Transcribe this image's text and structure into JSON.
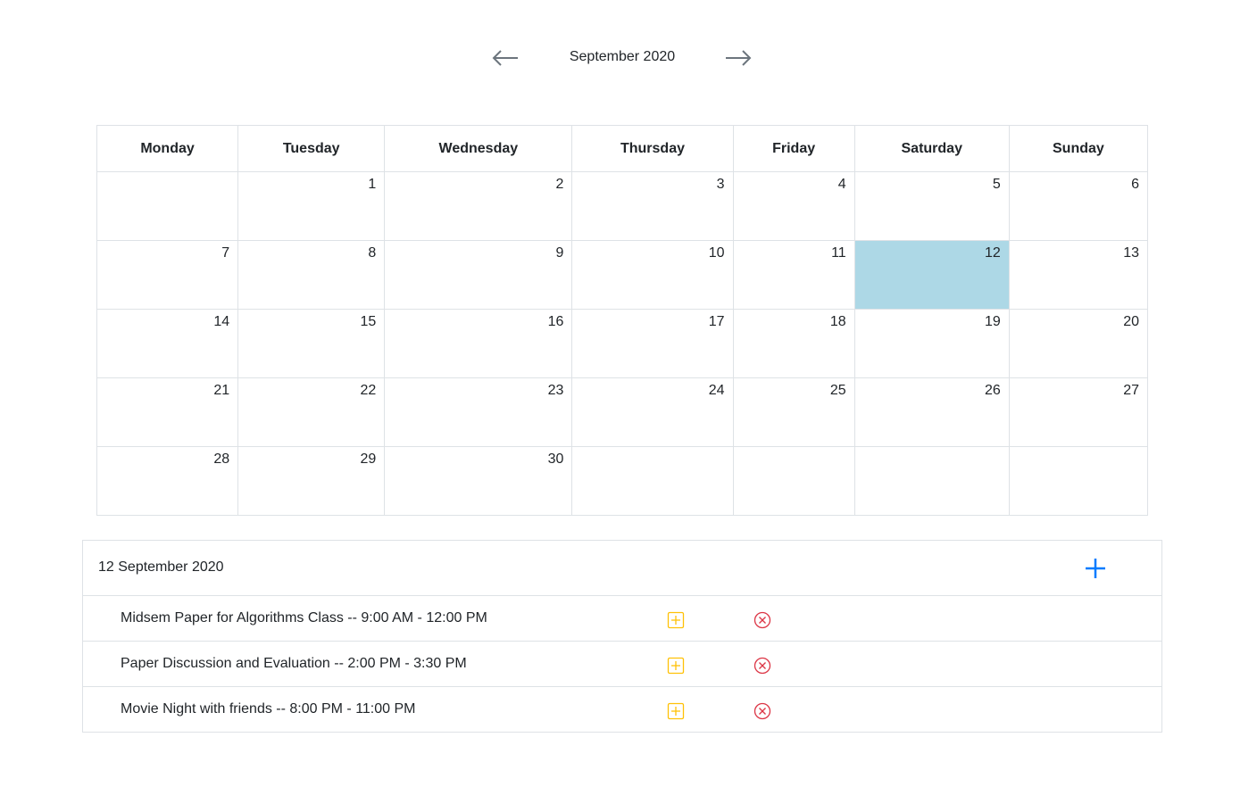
{
  "calendar": {
    "month_title": "September 2020",
    "weekdays": [
      "Monday",
      "Tuesday",
      "Wednesday",
      "Thursday",
      "Friday",
      "Saturday",
      "Sunday"
    ],
    "weeks": [
      [
        "",
        "1",
        "2",
        "3",
        "4",
        "5",
        "6"
      ],
      [
        "7",
        "8",
        "9",
        "10",
        "11",
        "12",
        "13"
      ],
      [
        "14",
        "15",
        "16",
        "17",
        "18",
        "19",
        "20"
      ],
      [
        "21",
        "22",
        "23",
        "24",
        "25",
        "26",
        "27"
      ],
      [
        "28",
        "29",
        "30",
        "",
        "",
        "",
        ""
      ]
    ],
    "selected_day": "12",
    "selected_color": "#add8e6"
  },
  "events_panel": {
    "date_label": "12 September 2020",
    "add_icon": "plus-icon",
    "add_color": "#007bff",
    "edit_color": "#ffc107",
    "delete_color": "#dc3545",
    "events": [
      {
        "text": "Midsem Paper for Algorithms Class -- 9:00 AM - 12:00 PM"
      },
      {
        "text": "Paper Discussion and Evaluation -- 2:00 PM - 3:30 PM"
      },
      {
        "text": "Movie Night with friends -- 8:00 PM - 11:00 PM"
      }
    ]
  }
}
